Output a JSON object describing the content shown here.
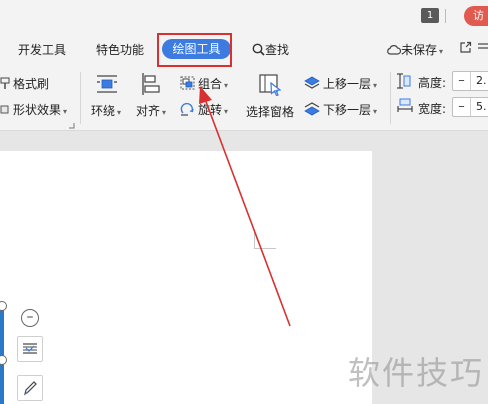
{
  "titlebar": {
    "window_count": "1",
    "visit_label": "访"
  },
  "tabs": {
    "items": [
      "开发工具",
      "特色功能",
      "绘图工具"
    ],
    "active": "绘图工具",
    "find": "查找",
    "unsaved": "未保存"
  },
  "ribbon": {
    "format_brush": "格式刷",
    "shape_effects": "形状效果",
    "wrap": "环绕",
    "align": "对齐",
    "group": "组合",
    "rotate": "旋转",
    "selection_pane": "选择窗格",
    "bring_forward": "上移一层",
    "send_backward": "下移一层",
    "height_label": "高度:",
    "width_label": "宽度:",
    "height_value": "2.",
    "width_value": "5."
  },
  "canvas": {
    "watermark": "软件技巧"
  },
  "colors": {
    "accent": "#3d7be0",
    "annotation": "#d83131",
    "visit": "#e05a4f"
  }
}
